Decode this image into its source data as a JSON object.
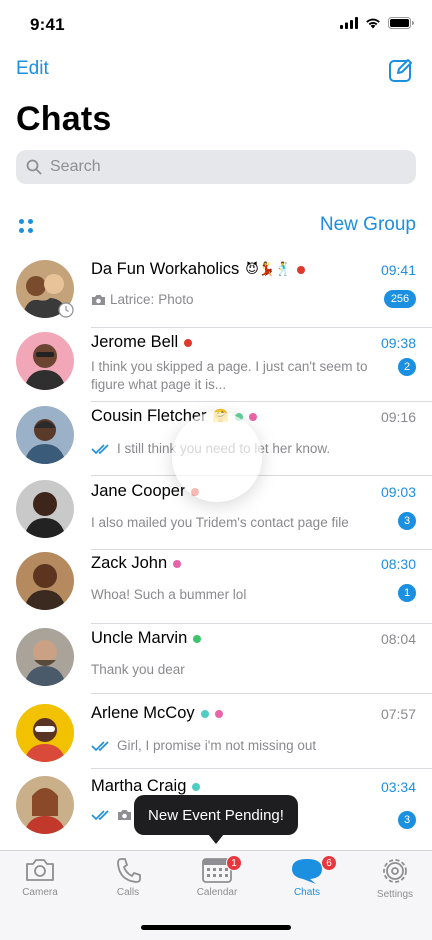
{
  "status_bar": {
    "time": "9:41"
  },
  "header": {
    "edit_label": "Edit",
    "title": "Chats",
    "new_group_label": "New Group"
  },
  "search": {
    "placeholder": "Search"
  },
  "colors": {
    "accent": "#1b8fe0",
    "badge_red": "#e8383d",
    "unread_badge": "#1b8fe0",
    "read_tick": "#1b8fe0"
  },
  "chats": [
    {
      "name": "Da Fun Workaholics",
      "emoji": "😈💃🕺",
      "time": "09:41",
      "time_highlight": true,
      "sender": "Latrice:",
      "preview": "Photo",
      "has_photo_icon": true,
      "badge": "256",
      "status_dots": [
        "#e0392c"
      ]
    },
    {
      "name": "Jerome Bell",
      "time": "09:38",
      "time_highlight": true,
      "preview": "I think you skipped a page. I just can't seem to figure what page it is...",
      "badge": "2",
      "status_dots": [
        "#e0392c"
      ]
    },
    {
      "name": "Cousin Fletcher",
      "emoji": "🤗",
      "time": "09:16",
      "time_highlight": false,
      "preview": "I still think you need to let her know.",
      "read_ticks": true,
      "status_dots": [
        "#66d19e",
        "#e964a8"
      ]
    },
    {
      "name": "Jane Cooper",
      "time": "09:03",
      "time_highlight": true,
      "preview": "I also mailed you Tridem's contact page file",
      "badge": "3",
      "status_dots": [
        "#e0392c"
      ]
    },
    {
      "name": "Zack John",
      "time": "08:30",
      "time_highlight": true,
      "preview": "Whoa! Such a bummer lol",
      "badge": "1",
      "status_dots": [
        "#e964a8"
      ]
    },
    {
      "name": "Uncle Marvin",
      "time": "08:04",
      "time_highlight": false,
      "preview": "Thank you dear",
      "status_dots": [
        "#3ec46d"
      ]
    },
    {
      "name": "Arlene McCoy",
      "time": "07:57",
      "time_highlight": false,
      "preview": "Girl, I promise i'm not missing out",
      "read_ticks": true,
      "status_dots": [
        "#4ecdc4",
        "#e964a8"
      ]
    },
    {
      "name": "Martha Craig",
      "time": "03:34",
      "time_highlight": true,
      "preview": "",
      "read_ticks": true,
      "has_photo_icon": true,
      "badge": "3",
      "status_dots": [
        "#4ecdc4"
      ]
    }
  ],
  "tooltip": {
    "text": "New Event Pending!"
  },
  "tabs": [
    {
      "label": "Camera",
      "icon": "camera-icon"
    },
    {
      "label": "Calls",
      "icon": "phone-icon"
    },
    {
      "label": "Calendar",
      "icon": "calendar-icon",
      "badge": "1"
    },
    {
      "label": "Chats",
      "icon": "chat-bubbles-icon",
      "badge": "6",
      "active": true
    },
    {
      "label": "Settings",
      "icon": "gear-icon"
    }
  ]
}
